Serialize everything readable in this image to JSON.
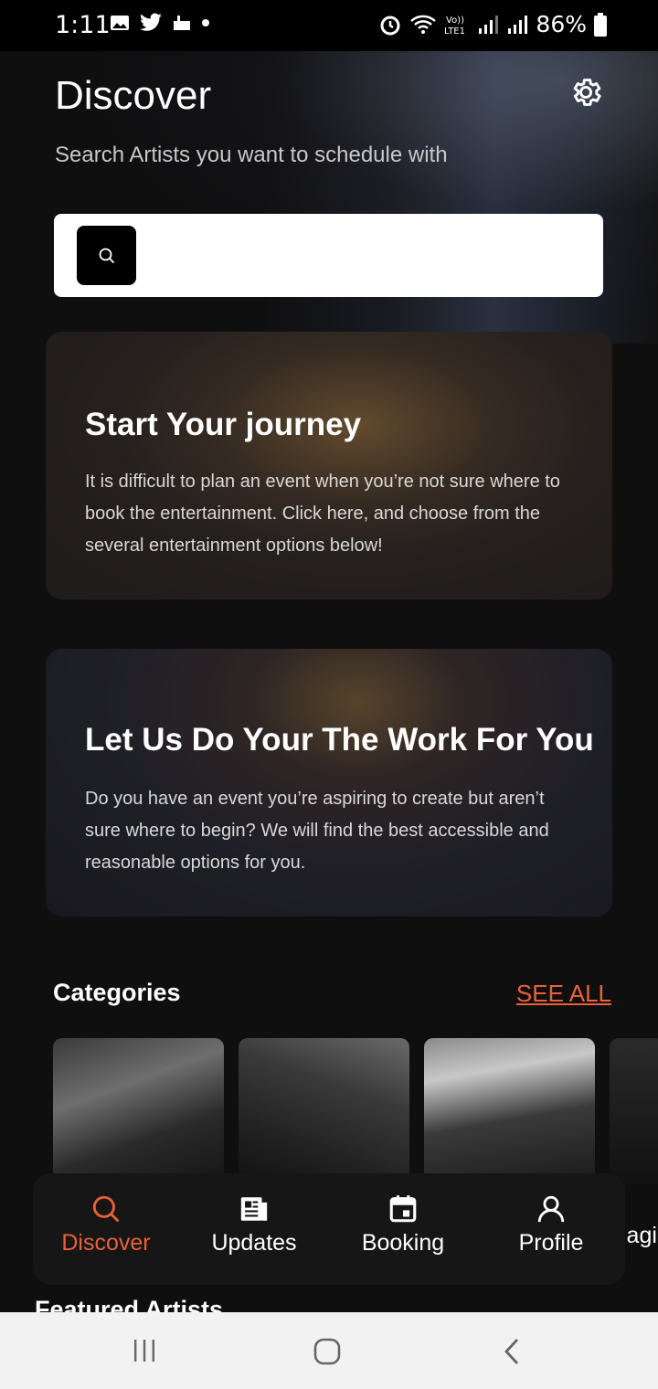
{
  "status_bar": {
    "time": "1:11",
    "battery": "86%"
  },
  "header": {
    "title": "Discover",
    "subtitle": "Search Artists you want to schedule with"
  },
  "search": {
    "placeholder": ""
  },
  "cards": [
    {
      "title": "Start Your journey",
      "text": "It is difficult to plan an event when you’re not sure where to book the entertainment. Click here, and choose from the several entertainment options below!"
    },
    {
      "title": "Let Us Do Your The Work For You",
      "text": "Do you have an event you’re aspiring to create but aren’t sure where to begin? We will find the best accessible and reasonable options for you."
    }
  ],
  "categories": {
    "title": "Categories",
    "see_all": "SEE ALL",
    "partial_label": "lagi"
  },
  "featured": {
    "title": "Featured Artists"
  },
  "nav": {
    "items": [
      {
        "label": "Discover",
        "icon": "search-icon",
        "active": true
      },
      {
        "label": "Updates",
        "icon": "newspaper-icon"
      },
      {
        "label": "Booking",
        "icon": "calendar-icon"
      },
      {
        "label": "Profile",
        "icon": "person-icon"
      }
    ]
  },
  "colors": {
    "accent": "#e8613a",
    "background": "#0f0f10"
  }
}
